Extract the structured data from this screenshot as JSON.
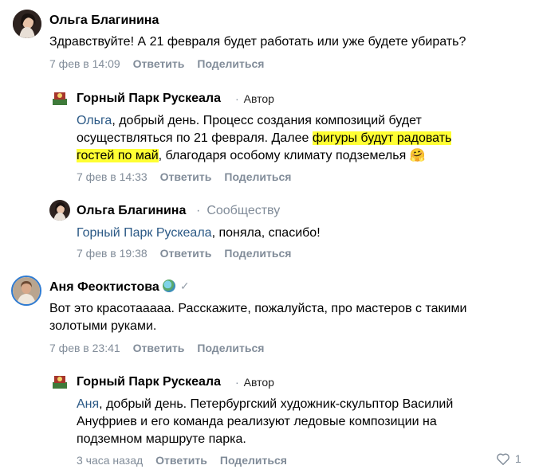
{
  "comments": [
    {
      "author": "Ольга Благинина",
      "text": "Здравствуйте! А 21 февраля будет работать или уже будете убирать?",
      "time": "7 фев в 14:09",
      "reply": "Ответить",
      "share": "Поделиться"
    },
    {
      "author": "Горный Парк Рускеала",
      "role": "Автор",
      "mention": "Ольга",
      "line1_rest": ", добрый день. Процесс создания композиций будет",
      "line2_a": "осуществляться по 21 февраля. Далее ",
      "line2_hl": "фигуры будут радовать",
      "line3_hl": "гостей по май",
      "line3_rest": ", благодаря особому климату подземелья ",
      "emoji": "🤗",
      "time": "7 фев в 14:33",
      "reply": "Ответить",
      "share": "Поделиться"
    },
    {
      "author": "Ольга Благинина",
      "to": "Сообществу",
      "mention": "Горный Парк Рускеала",
      "text_rest": ", поняла, спасибо!",
      "time": "7 фев в 19:38",
      "reply": "Ответить",
      "share": "Поделиться"
    },
    {
      "author": "Аня Феоктистова",
      "text_line1": "Вот это красотааааа. Расскажите, пожалуйста, про мастеров с такими",
      "text_line2": "золотыми руками.",
      "time": "7 фев в 23:41",
      "reply": "Ответить",
      "share": "Поделиться"
    },
    {
      "author": "Горный Парк Рускеала",
      "role": "Автор",
      "mention": "Аня",
      "line1_rest": ", добрый день. Петербургский художник-скульптор Василий",
      "line2": "Ануфриев и его команда реализуют ледовые композиции на",
      "line3": "подземном маршруте парка.",
      "time": "3 часа назад",
      "reply": "Ответить",
      "share": "Поделиться",
      "likes": "1"
    }
  ],
  "colors": {
    "link": "#2a5885",
    "meta": "#818c99",
    "highlight": "#ffff33"
  },
  "icons": {
    "verified": "checkmark-icon",
    "globe": "globe-emoji-icon",
    "like": "heart-icon"
  }
}
